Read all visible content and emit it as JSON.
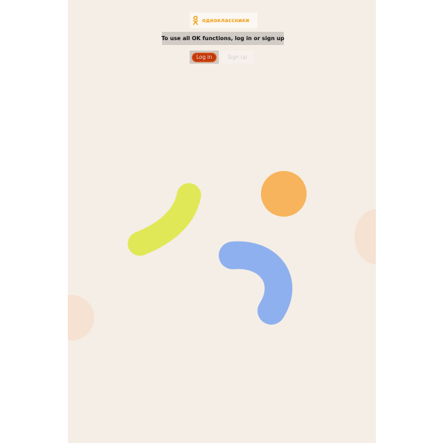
{
  "header": {
    "logo_text": "одноклассники",
    "logo_icon": "ok-logo-icon"
  },
  "auth": {
    "prompt": "To use all OK functions, log in or sign up",
    "login_label": "Log in",
    "signup_label": "Sign up"
  },
  "colors": {
    "background": "#f5eee6",
    "brand": "#f0a21b",
    "login_button": "#c23a0d",
    "shape_yellow": "#e0e857",
    "shape_orange": "#f7b45d",
    "shape_blue": "#8eb0ee",
    "shape_peach": "#f6e2d2"
  }
}
